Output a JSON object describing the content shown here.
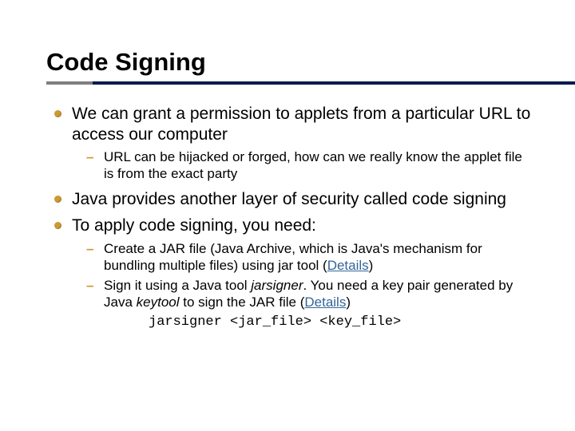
{
  "slide": {
    "title": "Code Signing",
    "bullets": {
      "b1": "We can grant a permission to applets from a particular URL to access our computer",
      "b1_sub1": "URL can be hijacked or forged, how can we really know the applet file is from the exact party",
      "b2": "Java provides another layer of security called code signing",
      "b3": "To apply code signing, you need:",
      "b3_sub1_a": "Create a JAR file (Java Archive, which is Java's mechanism for bundling multiple files) using jar tool (",
      "b3_sub1_link": "Details",
      "b3_sub1_b": ")",
      "b3_sub2_a": "Sign it using a Java tool ",
      "b3_sub2_italic1": "jarsigner",
      "b3_sub2_b": ". You need a key pair generated by Java ",
      "b3_sub2_italic2": "keytool",
      "b3_sub2_c": " to sign the JAR file (",
      "b3_sub2_link": "Details",
      "b3_sub2_d": ")",
      "code": "jarsigner <jar_file> <key_file>"
    }
  }
}
